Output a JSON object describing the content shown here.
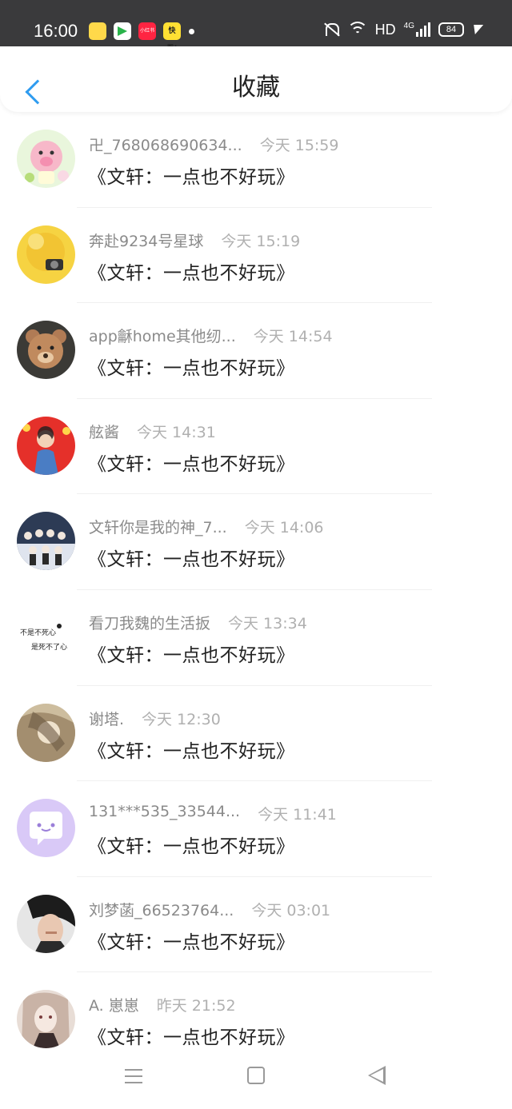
{
  "status_bar": {
    "time": "16:00",
    "network": "HD",
    "signal_type": "4G",
    "battery": "84",
    "apps": [
      "app-icon-1",
      "app-icon-2",
      "小红书",
      "快看!"
    ]
  },
  "header": {
    "title": "收藏",
    "back_icon": "chevron-left-icon",
    "accent": "#2f9cf0"
  },
  "items": [
    {
      "name": "卍_768068690634...",
      "time": "今天 15:59",
      "content": "《文轩：一点也不好玩》",
      "avatar_color": "#d8f0c8"
    },
    {
      "name": "奔赴9234号星球",
      "time": "今天 15:19",
      "content": "《文轩：一点也不好玩》",
      "avatar_color": "#f2d23c"
    },
    {
      "name": "app龢home其他纫...",
      "time": "今天 14:54",
      "content": "《文轩：一点也不好玩》",
      "avatar_color": "#b98a66"
    },
    {
      "name": "舷酱",
      "time": "今天 14:31",
      "content": "《文轩：一点也不好玩》",
      "avatar_color": "#e0322c"
    },
    {
      "name": "文轩你是我的神_7...",
      "time": "今天 14:06",
      "content": "《文轩：一点也不好玩》",
      "avatar_color": "#a9b6c8"
    },
    {
      "name": "看刀我魏的生活扳",
      "time": "今天 13:34",
      "content": "《文轩：一点也不好玩》",
      "avatar_color": "#ffffff"
    },
    {
      "name": "谢塔.",
      "time": "今天 12:30",
      "content": "《文轩：一点也不好玩》",
      "avatar_color": "#c9b699"
    },
    {
      "name": "131***535_33544...",
      "time": "今天 11:41",
      "content": "《文轩：一点也不好玩》",
      "avatar_color": "#d7c6f5"
    },
    {
      "name": "刘梦菡_66523764...",
      "time": "今天 03:01",
      "content": "《文轩：一点也不好玩》",
      "avatar_color": "#3a3634"
    },
    {
      "name": "A. 崽崽",
      "time": "昨天 21:52",
      "content": "《文轩：一点也不好玩》",
      "avatar_color": "#d9cfc9"
    }
  ],
  "avatar6_text": [
    "不是不死心",
    "是死不了心"
  ],
  "navbar": {
    "menu_icon": "menu-icon",
    "home_icon": "home-icon",
    "back_icon": "back-triangle-icon"
  }
}
